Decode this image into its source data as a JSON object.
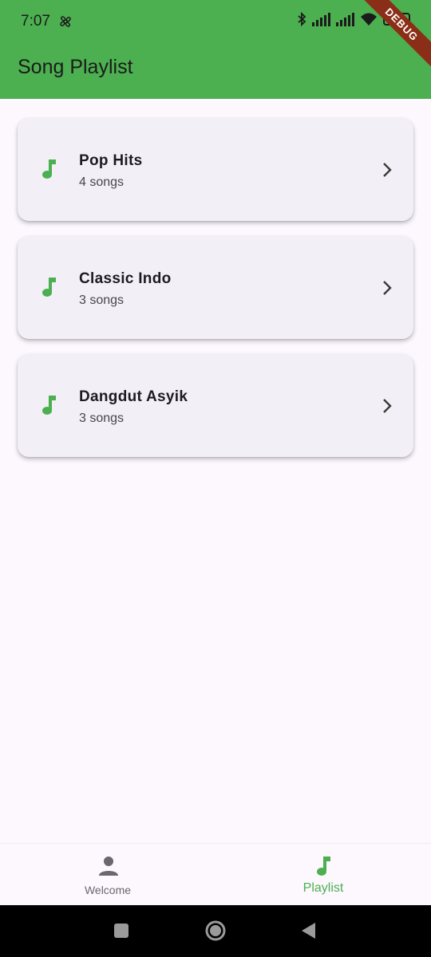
{
  "status_bar": {
    "time": "7:07",
    "battery": "100",
    "debug_banner": "DEBUG"
  },
  "app_bar": {
    "title": "Song Playlist"
  },
  "playlists": [
    {
      "title": "Pop Hits",
      "subtitle": "4 songs",
      "icon": "music-note-icon"
    },
    {
      "title": "Classic Indo",
      "subtitle": "3 songs",
      "icon": "music-note-icon"
    },
    {
      "title": "Dangdut Asyik",
      "subtitle": "3 songs",
      "icon": "music-note-icon"
    }
  ],
  "bottom_nav": {
    "items": [
      {
        "label": "Welcome",
        "icon": "person-icon",
        "selected": false
      },
      {
        "label": "Playlist",
        "icon": "music-note-icon",
        "selected": true
      }
    ]
  },
  "colors": {
    "primary": "#4caf50",
    "background": "#fdf7fe",
    "card": "#f3eff6",
    "text": "#1d1b20",
    "subtext": "#49454f"
  }
}
